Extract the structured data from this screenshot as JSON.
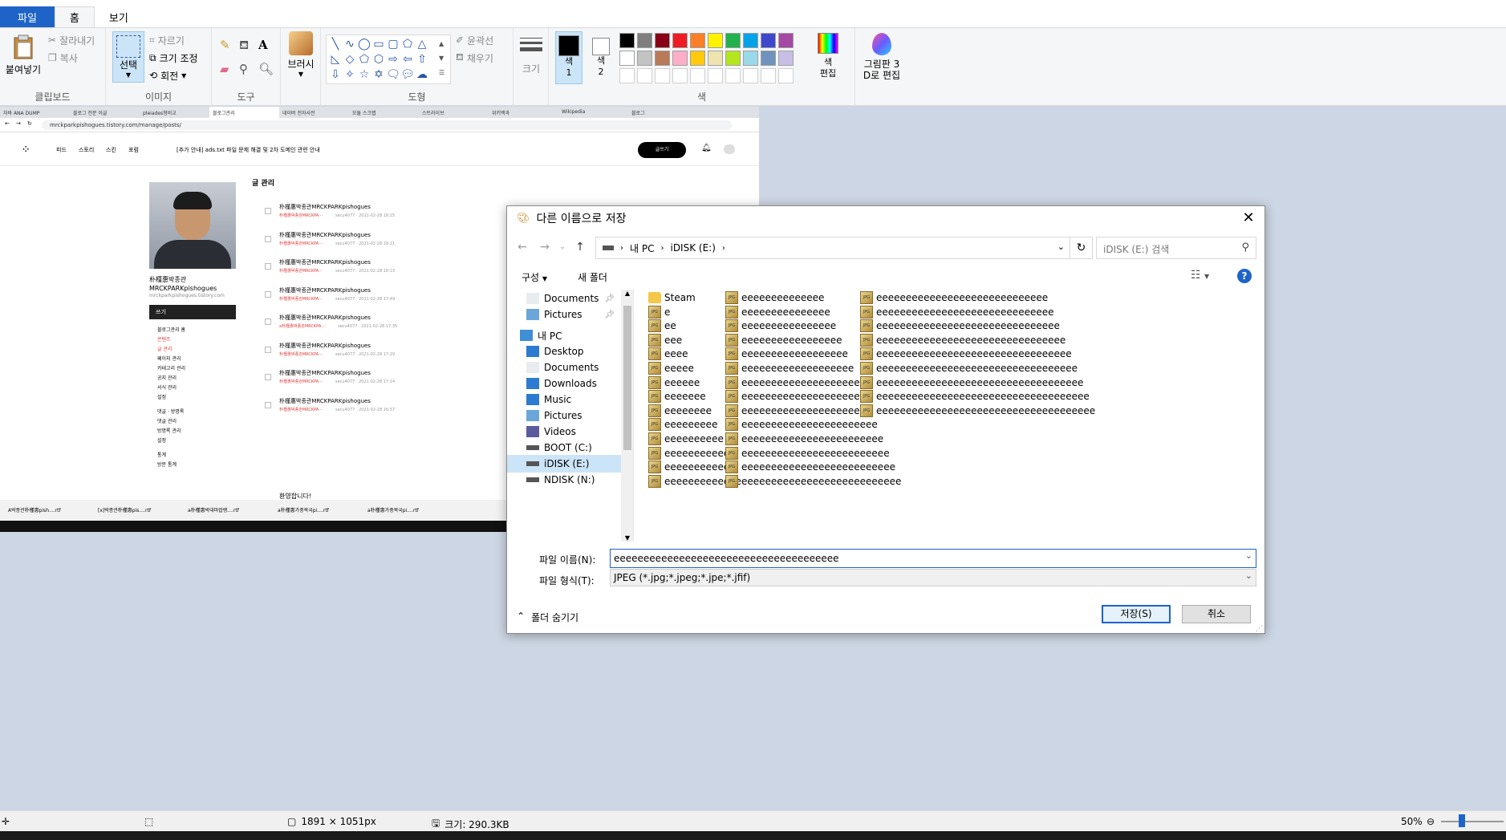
{
  "paint": {
    "tabs": [
      "파일",
      "홈",
      "보기"
    ],
    "clipboard": {
      "paste": "붙여넣기",
      "cut": "잘라내기",
      "copy": "복사",
      "label": "클립보드"
    },
    "image": {
      "select": "선택",
      "crop": "자르기",
      "resize": "크기 조정",
      "rotate": "회전",
      "label": "이미지"
    },
    "tools": {
      "label": "도구",
      "brush": "브러시"
    },
    "shapes": {
      "outline": "윤곽선",
      "fill": "채우기",
      "label": "도형"
    },
    "size_label": "크기",
    "color1": "색\n1",
    "color2": "색\n2",
    "edit_colors": "색\n편집",
    "paint3d": "그림판 3\nD로 편집",
    "colors_label": "색",
    "palette_row1": [
      "#000000",
      "#7f7f7f",
      "#880015",
      "#ed1c24",
      "#ff7f27",
      "#fff200",
      "#22b14c",
      "#00a2e8",
      "#3f48cc",
      "#a349a4"
    ],
    "palette_row2": [
      "#ffffff",
      "#c3c3c3",
      "#b97a57",
      "#ffaec9",
      "#ffc90e",
      "#efe4b0",
      "#b5e61d",
      "#99d9ea",
      "#7092be",
      "#c8bfe7"
    ]
  },
  "canvas": {
    "browser_tabs": [
      "자바 ANA DUMP",
      "블로그 전문 이글",
      "pleiades형비교",
      "블로그관리",
      "네이버 전자사전",
      "모듈 스크랩",
      "스트라이브",
      "위키백과",
      "Wikipedia",
      "블로그"
    ],
    "url": "mrckparkpishogues.tistory.com/manage/posts/",
    "nav": [
      "피드",
      "스토리",
      "스킨",
      "포럼"
    ],
    "notice": "[추가 안내] ads.txt 파일 문제 해결 및 2차 도메인 관련 안내",
    "write_button": "글쓰기",
    "profile_name": "朴槿惠박종관 MRCKPARKpishogues",
    "profile_url": "mrckparkpishogues.tistory.com",
    "dark_menu": "쓰기",
    "left_menu": [
      "블로그관리 홈",
      "콘텐츠",
      "글 관리",
      "페이지 관리",
      "카테고리 관리",
      "공지 관리",
      "서식 관리",
      "설정",
      "댓글 · 방명록",
      "댓글 관리",
      "방명록 관리",
      "설정",
      "통계",
      "방문 통계"
    ],
    "section_title": "글 관리",
    "posts": [
      {
        "title": "朴槿惠박종관MRCKPARKpishogues",
        "meta": "朴槿惠박종관MRCKPA···",
        "info": "secu4077 · 2021-02-28 18:25"
      },
      {
        "title": "朴槿惠박종관MRCKPARKpishogues",
        "meta": "朴槿惠박종관MRCKPA···",
        "info": "secu4077 · 2021-02-28 18:21"
      },
      {
        "title": "朴槿惠박종관MRCKPARKpishogues",
        "meta": "朴槿惠박종관MRCKPA···",
        "info": "secu4077 · 2021-02-28 18:13"
      },
      {
        "title": "朴槿惠박종관MRCKPARKpishogues",
        "meta": "朴槿惠박종관MRCKPA···",
        "info": "secu4077 · 2021-02-28 17:49"
      },
      {
        "title": "朴槿惠박종관MRCKPARKpishogues",
        "meta": "a朴槿惠박종관MRCKPA···",
        "info": "secu4077 · 2021-02-28 17:35"
      },
      {
        "title": "朴槿惠박종관MRCKPARKpishogues",
        "meta": "朴槿惠박종관MRCKPA···",
        "info": "secu4077 · 2021-02-28 17:29"
      },
      {
        "title": "朴槿惠박종관MRCKPARKpishogues",
        "meta": "朴槿惠박종관MRCKPA···",
        "info": "secu4077 · 2021-02-28 17:14"
      },
      {
        "title": "朴槿惠박종관MRCKPARKpishogues",
        "meta": "朴槿惠박종관MRCKPA···",
        "info": "secu4077 · 2021-02-28 16:57"
      }
    ],
    "welcome": "환영합니다!",
    "doc_tabs": [
      "A박종관朴槿惠pish....rtf",
      "[x]박종관朴槿惠pis....rtf",
      "a朴槿惠박대마랍랭....rtf",
      "a朴槿惠가중목국pi....rtf",
      "a朴槿惠가중목국pi....rtf"
    ]
  },
  "dialog": {
    "title": "다른 이름으로 저장",
    "path": [
      "내 PC",
      "iDISK (E:)"
    ],
    "search_placeholder": "iDISK (E:) 검색",
    "organize": "구성",
    "new_folder": "새 폴더",
    "help": "?",
    "nav": [
      {
        "label": "Documents",
        "pin": true
      },
      {
        "label": "Pictures",
        "pin": true
      },
      {
        "label": "내 PC"
      },
      {
        "label": "Desktop"
      },
      {
        "label": "Documents"
      },
      {
        "label": "Downloads"
      },
      {
        "label": "Music"
      },
      {
        "label": "Pictures"
      },
      {
        "label": "Videos"
      },
      {
        "label": "BOOT (C:)"
      },
      {
        "label": "iDISK (E:)",
        "selected": true
      },
      {
        "label": "NDISK (N:)"
      }
    ],
    "files_col1": [
      "Steam",
      "e",
      "ee",
      "eee",
      "eeee",
      "eeeee",
      "eeeeee",
      "eeeeeee",
      "eeeeeeee",
      "eeeeeeeee",
      "eeeeeeeeee",
      "eeeeeeeeeee",
      "eeeeeeeeeeee",
      "eeeeeeeeeeeee"
    ],
    "files_col2": [
      "eeeeeeeeeeeeee",
      "eeeeeeeeeeeeeee",
      "eeeeeeeeeeeeeeee",
      "eeeeeeeeeeeeeeeee",
      "eeeeeeeeeeeeeeeeee",
      "eeeeeeeeeeeeeeeeeee",
      "eeeeeeeeeeeeeeeeeeee",
      "eeeeeeeeeeeeeeeeeeeee",
      "eeeeeeeeeeeeeeeeeeeeee",
      "eeeeeeeeeeeeeeeeeeeeeee",
      "eeeeeeeeeeeeeeeeeeeeeeee",
      "eeeeeeeeeeeeeeeeeeeeeeeee",
      "eeeeeeeeeeeeeeeeeeeeeeeeee",
      "eeeeeeeeeeeeeeeeeeeeeeeeeee"
    ],
    "files_col3": [
      "eeeeeeeeeeeeeeeeeeeeeeeeeeeee",
      "eeeeeeeeeeeeeeeeeeeeeeeeeeeeee",
      "eeeeeeeeeeeeeeeeeeeeeeeeeeeeeee",
      "eeeeeeeeeeeeeeeeeeeeeeeeeeeeeeee",
      "eeeeeeeeeeeeeeeeeeeeeeeeeeeeeeeee",
      "eeeeeeeeeeeeeeeeeeeeeeeeeeeeeeeeee",
      "eeeeeeeeeeeeeeeeeeeeeeeeeeeeeeeeeee",
      "eeeeeeeeeeeeeeeeeeeeeeeeeeeeeeeeeeee",
      "eeeeeeeeeeeeeeeeeeeeeeeeeeeeeeeeeeeee"
    ],
    "filename_label": "파일 이름(N):",
    "filename_value": "eeeeeeeeeeeeeeeeeeeeeeeeeeeeeeeeeeeeee",
    "filetype_label": "파일 형식(T):",
    "filetype_value": "JPEG (*.jpg;*.jpeg;*.jpe;*.jfif)",
    "hide_folders": "폴더 숨기기",
    "save": "저장(S)",
    "cancel": "취소"
  },
  "status": {
    "dimensions": "1891 × 1051px",
    "size": "크기: 290.3KB",
    "zoom": "50%"
  }
}
